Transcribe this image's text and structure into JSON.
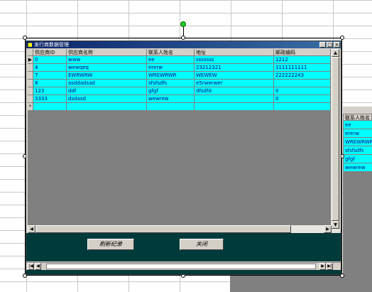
{
  "window": {
    "title": "发行商数据管理",
    "minimize_glyph": "_",
    "maximize_glyph": "□",
    "close_glyph": "×"
  },
  "grid": {
    "columns": [
      "供应商ID",
      "供应商名称",
      "联系人姓名",
      "地址",
      "邮政编码"
    ],
    "current_row_marker": "▶",
    "new_row_marker": "*",
    "rows": [
      [
        "0",
        "www",
        "ee",
        "sssssss",
        "1212"
      ],
      [
        "4",
        "wewqeq",
        "ererw",
        "23212321",
        "1111111111"
      ],
      [
        "7",
        "EWRWRW",
        "WREWRWR",
        "WEWEW",
        "222222243"
      ],
      [
        "8",
        "asddadsad",
        "sfsfsdfs",
        "e5rwerwer",
        ""
      ],
      [
        "123",
        "ddf",
        "gfgf",
        "dfsdfd",
        "0"
      ],
      [
        "3333",
        "dsdasd",
        "wewrew",
        "",
        "0"
      ]
    ]
  },
  "buttons": {
    "refresh": "刷新纪录",
    "close": "关闭"
  },
  "navigation": {
    "first": "|◀",
    "prev": "◀",
    "next": "▶",
    "last": "▶|"
  },
  "background_window": {
    "column_header": "联系人姓名",
    "values": [
      "ee",
      "ererw",
      "WREWRWR",
      "sfsfsdfs",
      "gfgf",
      "wewrew"
    ]
  },
  "colors": {
    "grid_cell": "#00ffff",
    "panel": "#003a3a",
    "titlebar": "#0a246a",
    "rotation_handle": "#22cc22"
  }
}
